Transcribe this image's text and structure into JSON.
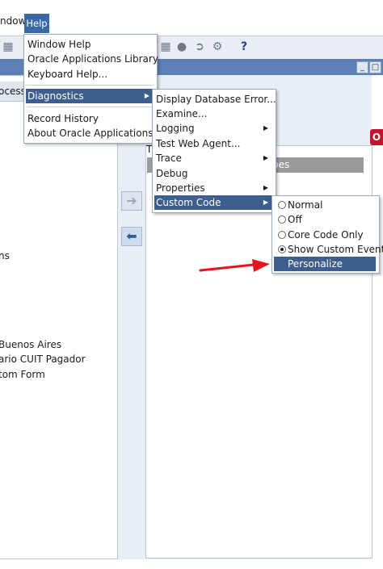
{
  "menubar": {
    "window_label": "ndow",
    "help_label": "Help"
  },
  "toolbar": {
    "help_icon": "?"
  },
  "left_panel": {
    "tab_label": "ocess",
    "texts": [
      "ns",
      "Buenos Aires",
      "ario CUIT Pagador",
      "tom Form"
    ]
  },
  "right_panel": {
    "fragment_t": "T",
    "header_label": "pes"
  },
  "help_menu": {
    "items": [
      "Window Help",
      "Oracle Applications Library",
      "Keyboard Help...",
      "Diagnostics",
      "Record History",
      "About Oracle Applications..."
    ]
  },
  "diagnostics_menu": {
    "items": [
      "Display Database Error...",
      "Examine...",
      "Logging",
      "Test Web Agent...",
      "Trace",
      "Debug",
      "Properties",
      "Custom Code"
    ]
  },
  "custom_code_menu": {
    "items": [
      "Normal",
      "Off",
      "Core Code Only",
      "Show Custom Events",
      "Personalize"
    ],
    "selected": "Show Custom Events"
  },
  "colors": {
    "accent": "#3d5e8f",
    "arrow": "#e8141c",
    "oracle_red": "#c8102e"
  }
}
